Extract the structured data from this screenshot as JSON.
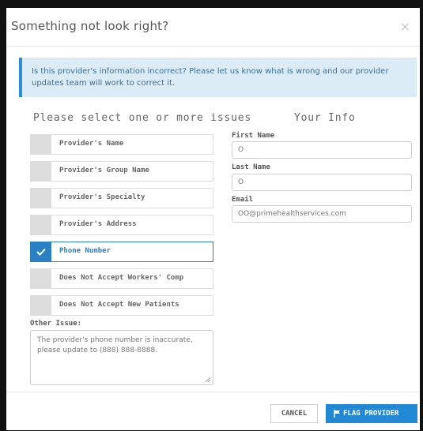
{
  "dialog": {
    "title": "Something not look right?",
    "close_glyph": "×",
    "banner": "Is this provider's information incorrect? Please let us know what is wrong and our provider updates team will work to correct it."
  },
  "issues": {
    "heading": "Please select one or more issues",
    "options": [
      {
        "label": "Provider's Name",
        "checked": false
      },
      {
        "label": "Provider's Group Name",
        "checked": false
      },
      {
        "label": "Provider's Specialty",
        "checked": false
      },
      {
        "label": "Provider's Address",
        "checked": false
      },
      {
        "label": "Phone Number",
        "checked": true
      },
      {
        "label": "Does Not Accept Workers' Comp",
        "checked": false
      },
      {
        "label": "Does Not Accept New Patients",
        "checked": false
      }
    ],
    "other_label": "Other Issue:",
    "other_value": "The provider's phone number is inaccurate, please update to (888) 888-8888."
  },
  "your_info": {
    "heading": "Your Info",
    "first_name_label": "First Name",
    "first_name_value": "O",
    "last_name_label": "Last Name",
    "last_name_value": "O",
    "email_label": "Email",
    "email_value": "OO@primehealthservices.com"
  },
  "footer": {
    "cancel_label": "CANCEL",
    "flag_label": "FLAG PROVIDER",
    "flag_icon": "flag-icon"
  },
  "colors": {
    "accent": "#2189d4",
    "banner_bg": "#dcecf7",
    "checkbox_bg": "#dddddd"
  }
}
